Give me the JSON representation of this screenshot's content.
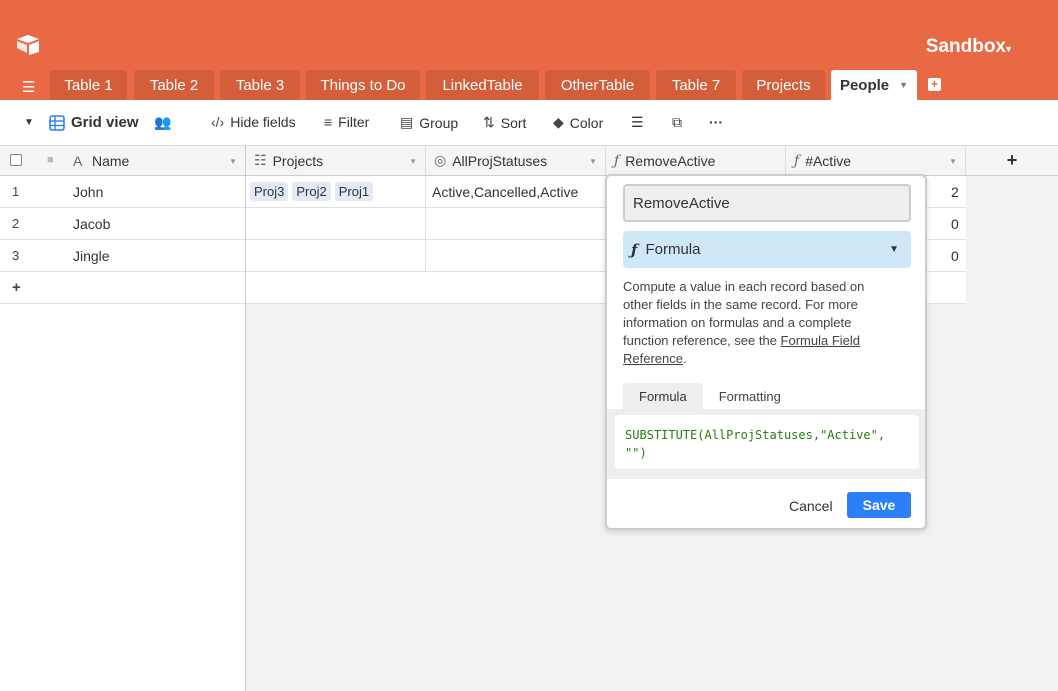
{
  "header": {
    "base_name": "Sandbox"
  },
  "tabs": [
    "Table 1",
    "Table 2",
    "Table 3",
    "Things to Do",
    "LinkedTable",
    "OtherTable",
    "Table 7",
    "Projects",
    "People"
  ],
  "toolbar": {
    "view_name": "Grid view",
    "hide_fields": "Hide fields",
    "filter": "Filter",
    "group": "Group",
    "sort": "Sort",
    "color": "Color",
    "more": "···"
  },
  "columns": {
    "name": "Name",
    "projects": "Projects",
    "allproj": "AllProjStatuses",
    "remove": "RemoveActive",
    "active": "#Active",
    "add": "+"
  },
  "rows": [
    {
      "num": "1",
      "name": "John",
      "projects": [
        "Proj3",
        "Proj2",
        "Proj1"
      ],
      "allproj": "Active,Cancelled,Active",
      "active": "2"
    },
    {
      "num": "2",
      "name": "Jacob",
      "projects": [],
      "allproj": "",
      "active": "0"
    },
    {
      "num": "3",
      "name": "Jingle",
      "projects": [],
      "allproj": "",
      "active": "0"
    }
  ],
  "add_row": "+",
  "popup": {
    "field_name": "RemoveActive",
    "field_type": "Formula",
    "desc_1": "Compute a value in each record based on other fields in the same record. For more information on formulas and a complete function reference, see the ",
    "desc_link": "Formula Field Reference",
    "desc_end": ".",
    "tab_formula": "Formula",
    "tab_formatting": "Formatting",
    "formula_line1": "SUBSTITUTE(AllProjStatuses,\"Active\",",
    "formula_line2": "\"\")",
    "cancel": "Cancel",
    "save": "Save"
  },
  "colors": {
    "brand": "#e86944",
    "save": "#2d7ff9",
    "formula_text": "#2c7a11"
  }
}
